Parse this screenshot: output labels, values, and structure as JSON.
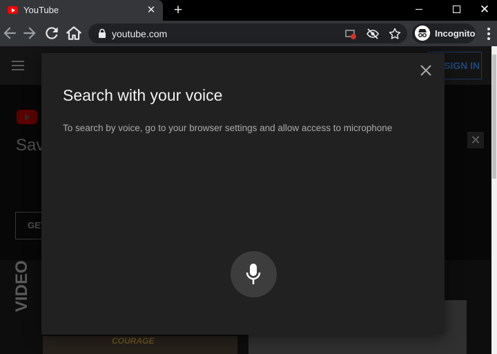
{
  "browser": {
    "tab_title": "YouTube",
    "tab_close": "✕",
    "new_tab": "+",
    "window_close": "✕",
    "url": "youtube.com",
    "profile_label": "Incognito"
  },
  "page": {
    "sign_in": "SIGN IN",
    "banner_text": "Sav",
    "get_button": "GET",
    "shelf_label": "VIDEO",
    "thumb_caption": "COURAGE",
    "banner_close": "✕"
  },
  "dialog": {
    "title": "Search with your voice",
    "message": "To search by voice, go to your browser settings and allow access to microphone"
  },
  "colors": {
    "youtube_red": "#ff0000",
    "dialog_bg": "#212121",
    "mic_button_bg": "#3d3d3d"
  }
}
